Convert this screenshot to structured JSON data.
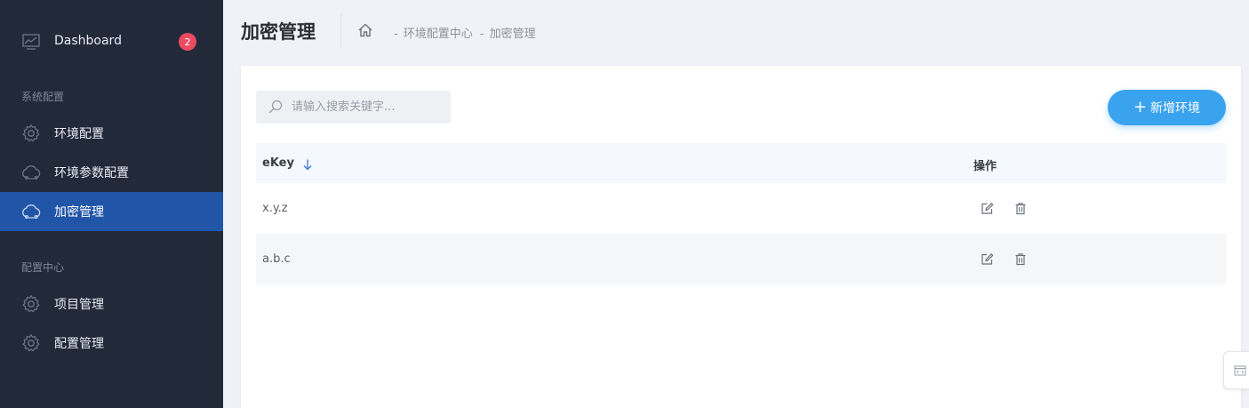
{
  "sidebar": {
    "dashboard": {
      "label": "Dashboard",
      "badge": "2",
      "icon": "chart-icon"
    },
    "section_system": "系统配置",
    "system_items": [
      {
        "label": "环境配置",
        "icon": "gear-icon"
      },
      {
        "label": "环境参数配置",
        "icon": "cloud-icon"
      },
      {
        "label": "加密管理",
        "icon": "cloud-icon",
        "active": true
      }
    ],
    "section_config": "配置中心",
    "config_items": [
      {
        "label": "项目管理",
        "icon": "gear-icon"
      },
      {
        "label": "配置管理",
        "icon": "gear-icon"
      }
    ]
  },
  "header": {
    "title": "加密管理",
    "breadcrumb": [
      "环境配置中心",
      "加密管理"
    ],
    "separator": "-"
  },
  "toolbar": {
    "search_placeholder": "请输入搜索关键字...",
    "search_value": "",
    "add_label": "新增环境"
  },
  "table": {
    "columns": [
      "eKey",
      "操作"
    ],
    "rows": [
      {
        "ekey": "x.y.z"
      },
      {
        "ekey": "a.b.c"
      }
    ]
  },
  "colors": {
    "sidebar_bg": "#222a3a",
    "active_bg": "#2155a8",
    "accent": "#3aa3ef",
    "badge": "#ec4a5f"
  }
}
